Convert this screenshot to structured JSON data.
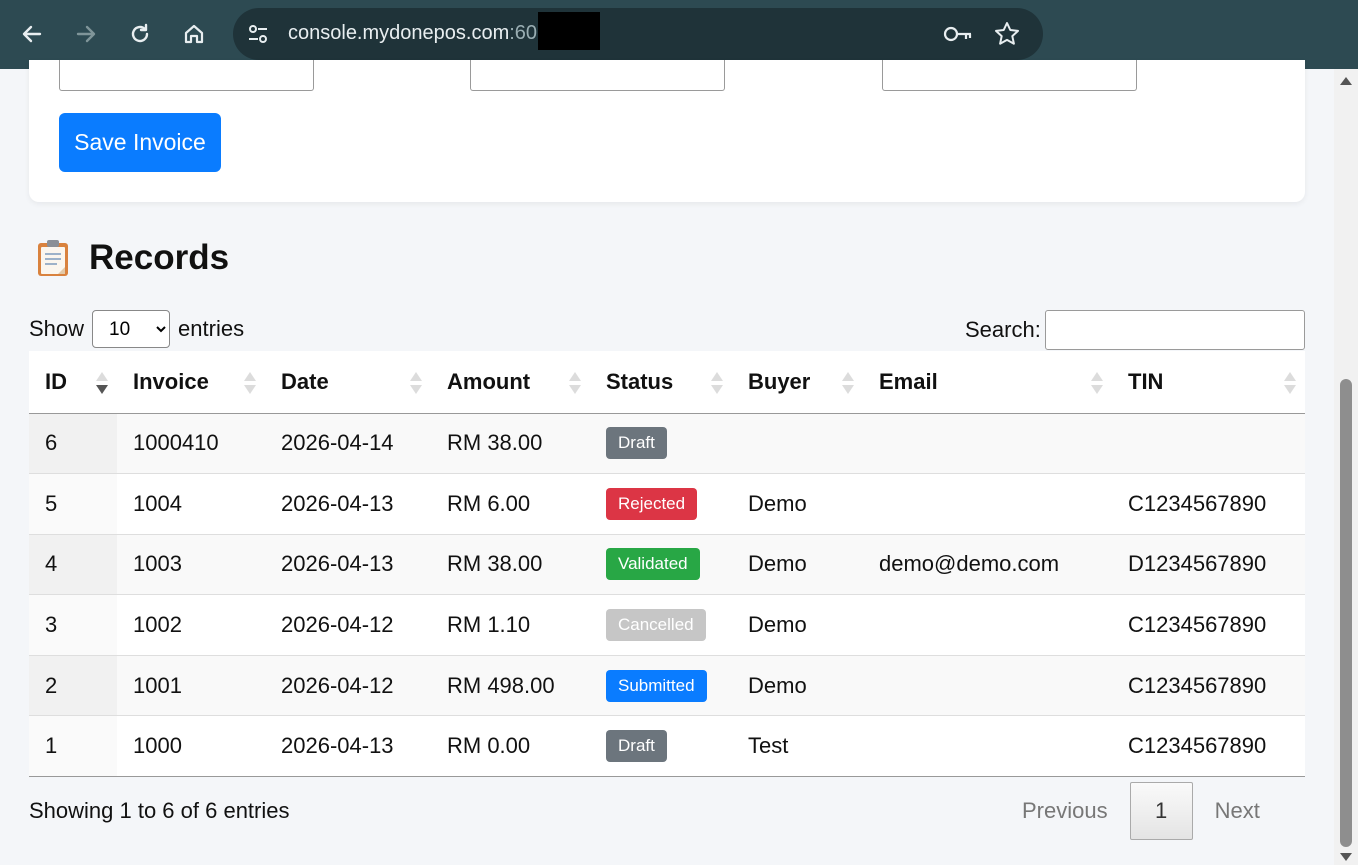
{
  "browser": {
    "url_host": "console.mydonepos.com",
    "url_port_visible": ":60"
  },
  "form": {
    "save_label": "Save Invoice"
  },
  "records": {
    "title": "Records",
    "length_prefix": "Show",
    "length_value": "10",
    "length_suffix": "entries",
    "search_label": "Search:",
    "columns": [
      "ID",
      "Invoice",
      "Date",
      "Amount",
      "Status",
      "Buyer",
      "Email",
      "TIN"
    ],
    "rows": [
      {
        "id": "6",
        "invoice": "1000410",
        "date": "2026-04-14",
        "amount": "RM 38.00",
        "status": "Draft",
        "status_color": "#6c757d",
        "buyer": "",
        "email": "",
        "tin": ""
      },
      {
        "id": "5",
        "invoice": "1004",
        "date": "2026-04-13",
        "amount": "RM 6.00",
        "status": "Rejected",
        "status_color": "#dc3545",
        "buyer": "Demo",
        "email": "",
        "tin": "C1234567890"
      },
      {
        "id": "4",
        "invoice": "1003",
        "date": "2026-04-13",
        "amount": "RM 38.00",
        "status": "Validated",
        "status_color": "#28a745",
        "buyer": "Demo",
        "email": "demo@demo.com",
        "tin": "D1234567890"
      },
      {
        "id": "3",
        "invoice": "1002",
        "date": "2026-04-12",
        "amount": "RM 1.10",
        "status": "Cancelled",
        "status_color": "#c6c6c6",
        "buyer": "Demo",
        "email": "",
        "tin": "C1234567890"
      },
      {
        "id": "2",
        "invoice": "1001",
        "date": "2026-04-12",
        "amount": "RM 498.00",
        "status": "Submitted",
        "status_color": "#0a7cff",
        "buyer": "Demo",
        "email": "",
        "tin": "C1234567890"
      },
      {
        "id": "1",
        "invoice": "1000",
        "date": "2026-04-13",
        "amount": "RM 0.00",
        "status": "Draft",
        "status_color": "#6c757d",
        "buyer": "Test",
        "email": "",
        "tin": "C1234567890"
      }
    ],
    "info": "Showing 1 to 6 of 6 entries",
    "pager": {
      "previous": "Previous",
      "current": "1",
      "next": "Next"
    }
  },
  "icons": {
    "back": "arrow-left-icon",
    "forward": "arrow-right-icon",
    "reload": "reload-icon",
    "home": "home-icon",
    "site_info": "tune-icon",
    "passwords": "key-icon",
    "bookmark": "star-icon",
    "records": "clipboard-icon"
  }
}
